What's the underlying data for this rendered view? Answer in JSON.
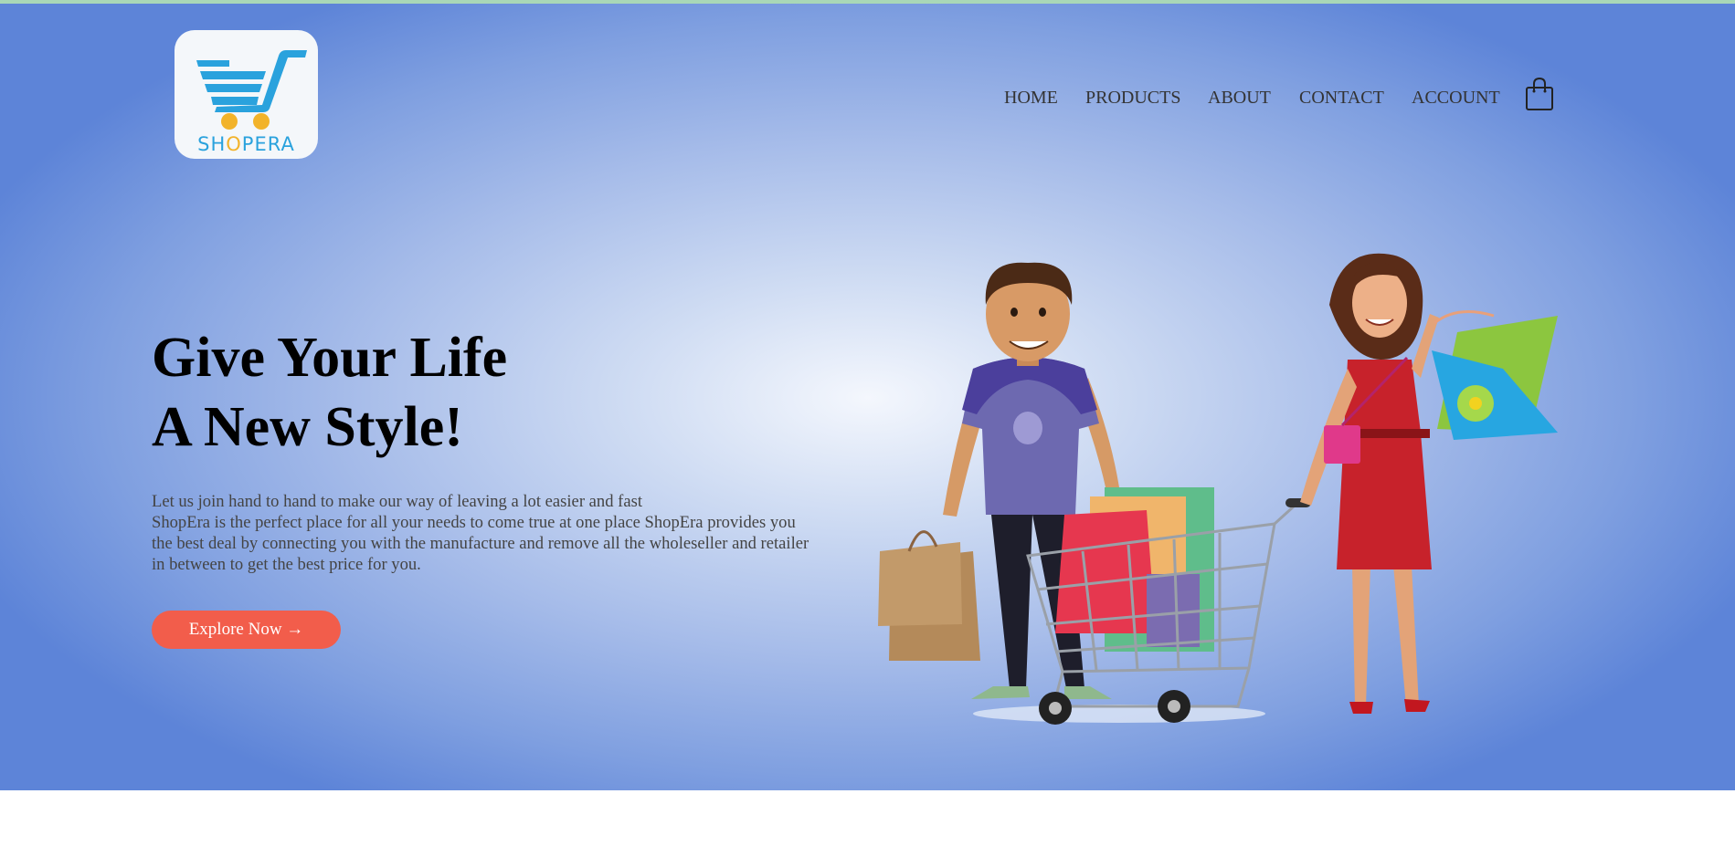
{
  "brand": {
    "logo_prefix": "SH",
    "logo_o": "O",
    "logo_suffix": "PERA"
  },
  "nav": {
    "home": "HOME",
    "products": "PRODUCTS",
    "about": "ABOUT",
    "contact": "CONTACT",
    "account": "ACCOUNT",
    "cart_icon": "shopping-bag-icon"
  },
  "hero": {
    "headline_line1": "Give Your Life",
    "headline_line2": "A New Style!",
    "desc_line1": "Let us join hand to hand to make our way of leaving a lot easier and fast",
    "desc_line2": "ShopEra is the perfect place for all your needs to come true at one place ShopEra provides you",
    "desc_line3": "the best deal by connecting you with the manufacture and remove all the wholeseller and retailer",
    "desc_line4": "in between to get the best price for you.",
    "cta_label": "Explore Now →"
  },
  "colors": {
    "accent": "#f25d4b",
    "logo_blue": "#2aa2dd",
    "logo_yellow": "#f2b32a",
    "hero_edge": "#5d84d8",
    "hero_center": "#f4f7fd"
  }
}
